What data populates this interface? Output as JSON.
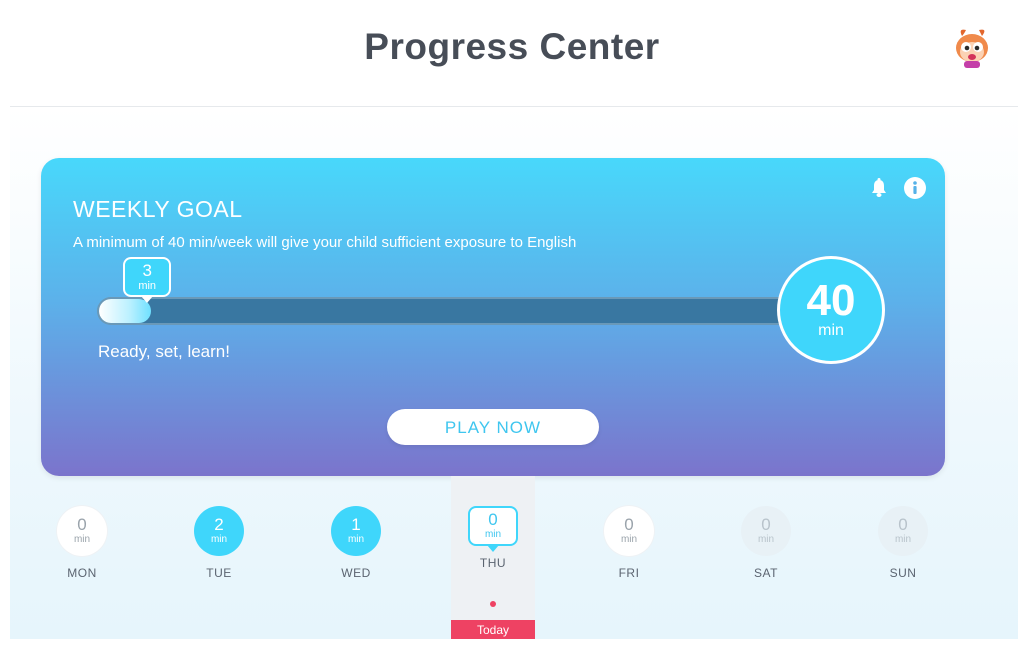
{
  "header": {
    "title": "Progress Center",
    "avatar_icon": "cartoon-character-avatar"
  },
  "goal": {
    "title": "WEEKLY GOAL",
    "subtitle": "A minimum of 40 min/week will give your child sufficient exposure to English",
    "current_value": "3",
    "current_unit": "min",
    "progress_fraction": 0.075,
    "target_value": "40",
    "target_unit": "min",
    "status": "Ready, set, learn!",
    "play_label": "PLAY NOW",
    "icons": [
      "bell-icon",
      "info-icon"
    ],
    "colors": {
      "gradient_top": "#48d8fb",
      "gradient_bottom": "#7b74cc",
      "accent": "#3fd6fb"
    }
  },
  "week": {
    "days": [
      {
        "label": "MON",
        "value": "0",
        "unit": "min",
        "state": "zero"
      },
      {
        "label": "TUE",
        "value": "2",
        "unit": "min",
        "state": "active"
      },
      {
        "label": "WED",
        "value": "1",
        "unit": "min",
        "state": "active"
      },
      {
        "label": "THU",
        "value": "0",
        "unit": "min",
        "state": "today"
      },
      {
        "label": "FRI",
        "value": "0",
        "unit": "min",
        "state": "zero"
      },
      {
        "label": "SAT",
        "value": "0",
        "unit": "min",
        "state": "future"
      },
      {
        "label": "SUN",
        "value": "0",
        "unit": "min",
        "state": "future"
      }
    ],
    "today_label": "Today",
    "today_color": "#ee4263"
  }
}
